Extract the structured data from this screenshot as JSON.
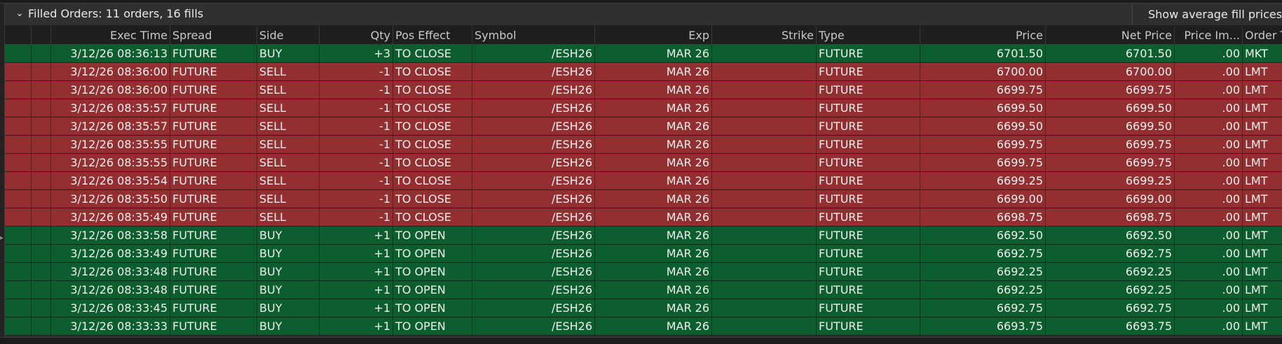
{
  "panel": {
    "title": "Filled Orders: 11 orders, 16 fills",
    "avg_button_label": "Show average fill prices",
    "left_handle_glyph": "▸",
    "chevron_glyph": "⌄"
  },
  "columns": [
    "Exec Time",
    "Spread",
    "Side",
    "Qty",
    "Pos Effect",
    "Symbol",
    "Exp",
    "Strike",
    "Type",
    "Price",
    "Net Price",
    "Price Im...",
    "Order T"
  ],
  "colors": {
    "buy_row": "#0c5e2e",
    "sell_row": "#932f30"
  },
  "rows": [
    {
      "exec_time": "3/12/26 08:36:13",
      "spread": "FUTURE",
      "side": "BUY",
      "qty": "+3",
      "pos_effect": "TO CLOSE",
      "symbol": "/ESH26",
      "exp": "MAR 26",
      "strike": "",
      "type": "FUTURE",
      "price": "6701.50",
      "net_price": "6701.50",
      "price_impr": ".00",
      "order_type": "MKT"
    },
    {
      "exec_time": "3/12/26 08:36:00",
      "spread": "FUTURE",
      "side": "SELL",
      "qty": "-1",
      "pos_effect": "TO CLOSE",
      "symbol": "/ESH26",
      "exp": "MAR 26",
      "strike": "",
      "type": "FUTURE",
      "price": "6700.00",
      "net_price": "6700.00",
      "price_impr": ".00",
      "order_type": "LMT"
    },
    {
      "exec_time": "3/12/26 08:36:00",
      "spread": "FUTURE",
      "side": "SELL",
      "qty": "-1",
      "pos_effect": "TO CLOSE",
      "symbol": "/ESH26",
      "exp": "MAR 26",
      "strike": "",
      "type": "FUTURE",
      "price": "6699.75",
      "net_price": "6699.75",
      "price_impr": ".00",
      "order_type": "LMT"
    },
    {
      "exec_time": "3/12/26 08:35:57",
      "spread": "FUTURE",
      "side": "SELL",
      "qty": "-1",
      "pos_effect": "TO CLOSE",
      "symbol": "/ESH26",
      "exp": "MAR 26",
      "strike": "",
      "type": "FUTURE",
      "price": "6699.50",
      "net_price": "6699.50",
      "price_impr": ".00",
      "order_type": "LMT"
    },
    {
      "exec_time": "3/12/26 08:35:57",
      "spread": "FUTURE",
      "side": "SELL",
      "qty": "-1",
      "pos_effect": "TO CLOSE",
      "symbol": "/ESH26",
      "exp": "MAR 26",
      "strike": "",
      "type": "FUTURE",
      "price": "6699.50",
      "net_price": "6699.50",
      "price_impr": ".00",
      "order_type": "LMT"
    },
    {
      "exec_time": "3/12/26 08:35:55",
      "spread": "FUTURE",
      "side": "SELL",
      "qty": "-1",
      "pos_effect": "TO CLOSE",
      "symbol": "/ESH26",
      "exp": "MAR 26",
      "strike": "",
      "type": "FUTURE",
      "price": "6699.75",
      "net_price": "6699.75",
      "price_impr": ".00",
      "order_type": "LMT"
    },
    {
      "exec_time": "3/12/26 08:35:55",
      "spread": "FUTURE",
      "side": "SELL",
      "qty": "-1",
      "pos_effect": "TO CLOSE",
      "symbol": "/ESH26",
      "exp": "MAR 26",
      "strike": "",
      "type": "FUTURE",
      "price": "6699.75",
      "net_price": "6699.75",
      "price_impr": ".00",
      "order_type": "LMT"
    },
    {
      "exec_time": "3/12/26 08:35:54",
      "spread": "FUTURE",
      "side": "SELL",
      "qty": "-1",
      "pos_effect": "TO CLOSE",
      "symbol": "/ESH26",
      "exp": "MAR 26",
      "strike": "",
      "type": "FUTURE",
      "price": "6699.25",
      "net_price": "6699.25",
      "price_impr": ".00",
      "order_type": "LMT"
    },
    {
      "exec_time": "3/12/26 08:35:50",
      "spread": "FUTURE",
      "side": "SELL",
      "qty": "-1",
      "pos_effect": "TO CLOSE",
      "symbol": "/ESH26",
      "exp": "MAR 26",
      "strike": "",
      "type": "FUTURE",
      "price": "6699.00",
      "net_price": "6699.00",
      "price_impr": ".00",
      "order_type": "LMT"
    },
    {
      "exec_time": "3/12/26 08:35:49",
      "spread": "FUTURE",
      "side": "SELL",
      "qty": "-1",
      "pos_effect": "TO CLOSE",
      "symbol": "/ESH26",
      "exp": "MAR 26",
      "strike": "",
      "type": "FUTURE",
      "price": "6698.75",
      "net_price": "6698.75",
      "price_impr": ".00",
      "order_type": "LMT"
    },
    {
      "exec_time": "3/12/26 08:33:58",
      "spread": "FUTURE",
      "side": "BUY",
      "qty": "+1",
      "pos_effect": "TO OPEN",
      "symbol": "/ESH26",
      "exp": "MAR 26",
      "strike": "",
      "type": "FUTURE",
      "price": "6692.50",
      "net_price": "6692.50",
      "price_impr": ".00",
      "order_type": "LMT"
    },
    {
      "exec_time": "3/12/26 08:33:49",
      "spread": "FUTURE",
      "side": "BUY",
      "qty": "+1",
      "pos_effect": "TO OPEN",
      "symbol": "/ESH26",
      "exp": "MAR 26",
      "strike": "",
      "type": "FUTURE",
      "price": "6692.75",
      "net_price": "6692.75",
      "price_impr": ".00",
      "order_type": "LMT"
    },
    {
      "exec_time": "3/12/26 08:33:48",
      "spread": "FUTURE",
      "side": "BUY",
      "qty": "+1",
      "pos_effect": "TO OPEN",
      "symbol": "/ESH26",
      "exp": "MAR 26",
      "strike": "",
      "type": "FUTURE",
      "price": "6692.25",
      "net_price": "6692.25",
      "price_impr": ".00",
      "order_type": "LMT"
    },
    {
      "exec_time": "3/12/26 08:33:48",
      "spread": "FUTURE",
      "side": "BUY",
      "qty": "+1",
      "pos_effect": "TO OPEN",
      "symbol": "/ESH26",
      "exp": "MAR 26",
      "strike": "",
      "type": "FUTURE",
      "price": "6692.25",
      "net_price": "6692.25",
      "price_impr": ".00",
      "order_type": "LMT"
    },
    {
      "exec_time": "3/12/26 08:33:45",
      "spread": "FUTURE",
      "side": "BUY",
      "qty": "+1",
      "pos_effect": "TO OPEN",
      "symbol": "/ESH26",
      "exp": "MAR 26",
      "strike": "",
      "type": "FUTURE",
      "price": "6692.75",
      "net_price": "6692.75",
      "price_impr": ".00",
      "order_type": "LMT"
    },
    {
      "exec_time": "3/12/26 08:33:33",
      "spread": "FUTURE",
      "side": "BUY",
      "qty": "+1",
      "pos_effect": "TO OPEN",
      "symbol": "/ESH26",
      "exp": "MAR 26",
      "strike": "",
      "type": "FUTURE",
      "price": "6693.75",
      "net_price": "6693.75",
      "price_impr": ".00",
      "order_type": "LMT"
    }
  ]
}
